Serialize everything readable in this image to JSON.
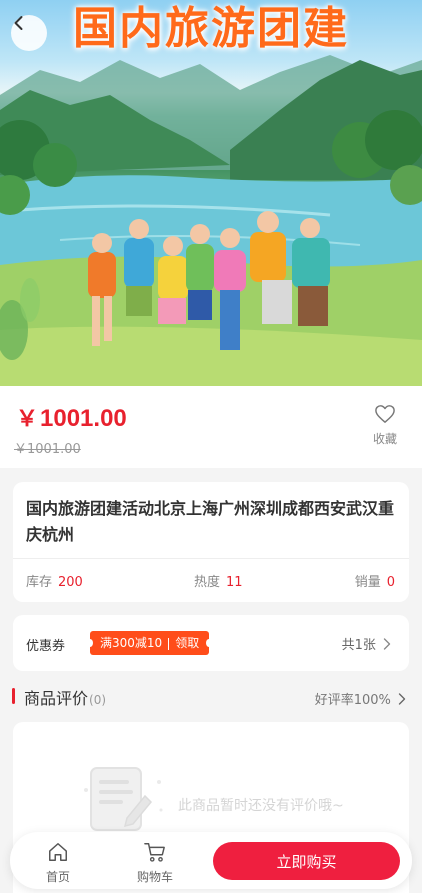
{
  "hero": {
    "title": "国内旅游团建"
  },
  "price": {
    "symbol": "￥",
    "current": "1001.00",
    "original": "￥1001.00",
    "favorite_label": "收藏"
  },
  "goods": {
    "title": "国内旅游团建活动北京上海广州深圳成都西安武汉重庆杭州",
    "stats": [
      {
        "label": "库存",
        "value": "200"
      },
      {
        "label": "热度",
        "value": "11"
      },
      {
        "label": "销量",
        "value": "0"
      }
    ]
  },
  "coupon": {
    "label": "优惠券",
    "tag_text": "满300减10",
    "tag_action": "领取",
    "count_text": "共1张"
  },
  "reviews": {
    "title": "商品评价",
    "count": "(0)",
    "rate_text": "好评率100%",
    "empty_text": "此商品暂时还没有评价哦~"
  },
  "bottom_bar": {
    "home_label": "首页",
    "cart_label": "购物车",
    "buy_label": "立即购买"
  },
  "colors": {
    "accent_red": "#e8212e",
    "buy_button": "#ef1f3f",
    "coupon_orange": "#ff4d1a",
    "title_orange": "#ff6a1a"
  }
}
